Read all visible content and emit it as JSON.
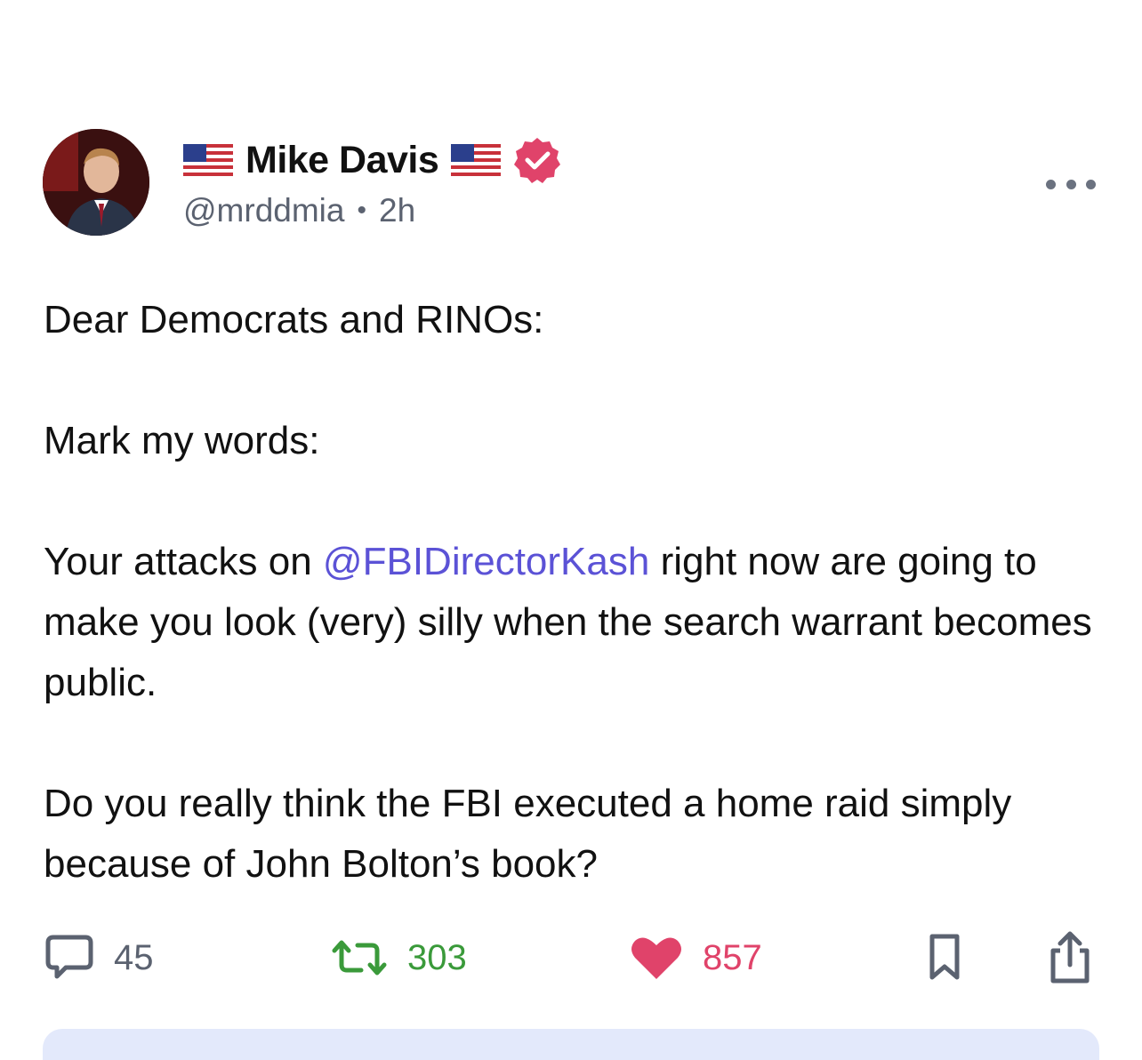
{
  "post": {
    "author": {
      "display_name": "Mike Davis",
      "handle": "@mrddmia",
      "time": "2h",
      "separator": "•",
      "verified": true,
      "name_prefix_emoji": "us-flag",
      "name_suffix_emoji": "us-flag"
    },
    "body": {
      "line1": "Dear Democrats and RINOs:",
      "line2": "Mark my words:",
      "line3_pre": "Your attacks on ",
      "mention": "@FBIDirectorKash",
      "line3_post": " right now are going to make you look (very) silly when the search warrant becomes public.",
      "line4": "Do you really think the FBI executed a home raid simply because of John Bolton’s book?"
    },
    "stats": {
      "replies": "45",
      "reposts": "303",
      "likes": "857"
    },
    "icons": {
      "reply": "speech-bubble-icon",
      "repost": "repost-arrows-icon",
      "like": "heart-icon",
      "bookmark": "bookmark-icon",
      "share": "share-icon",
      "more": "more-horizontal-icon",
      "verified": "verified-badge-icon"
    },
    "colors": {
      "mention": "#5b52d6",
      "repost": "#3a9a3a",
      "like": "#e0436a",
      "verified": "#e0436a",
      "muted": "#5b6270"
    }
  }
}
